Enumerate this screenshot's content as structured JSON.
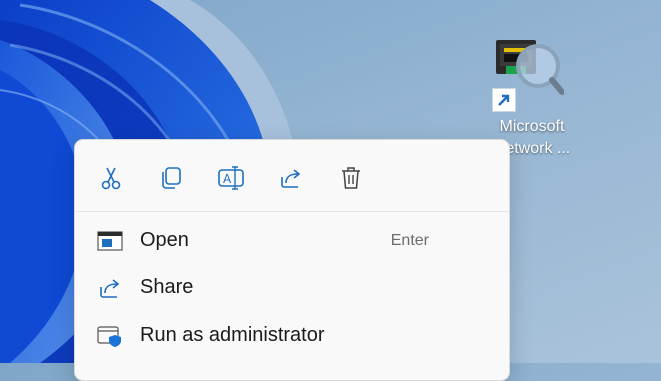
{
  "desktop": {
    "icon_label": "Microsoft\nNetwork ..."
  },
  "menu": {
    "quick_actions": [
      {
        "name": "cut",
        "icon": "scissors-icon"
      },
      {
        "name": "copy",
        "icon": "copy-icon"
      },
      {
        "name": "rename",
        "icon": "rename-icon"
      },
      {
        "name": "share",
        "icon": "share-icon"
      },
      {
        "name": "delete",
        "icon": "trash-icon"
      }
    ],
    "items": [
      {
        "label": "Open",
        "accelerator": "Enter",
        "icon": "window-icon"
      },
      {
        "label": "Share",
        "icon": "share-icon"
      },
      {
        "label": "Run as administrator",
        "icon": "shield-window-icon"
      }
    ]
  },
  "colors": {
    "accent": "#1f6fbf",
    "shield": "#1a73d9"
  }
}
